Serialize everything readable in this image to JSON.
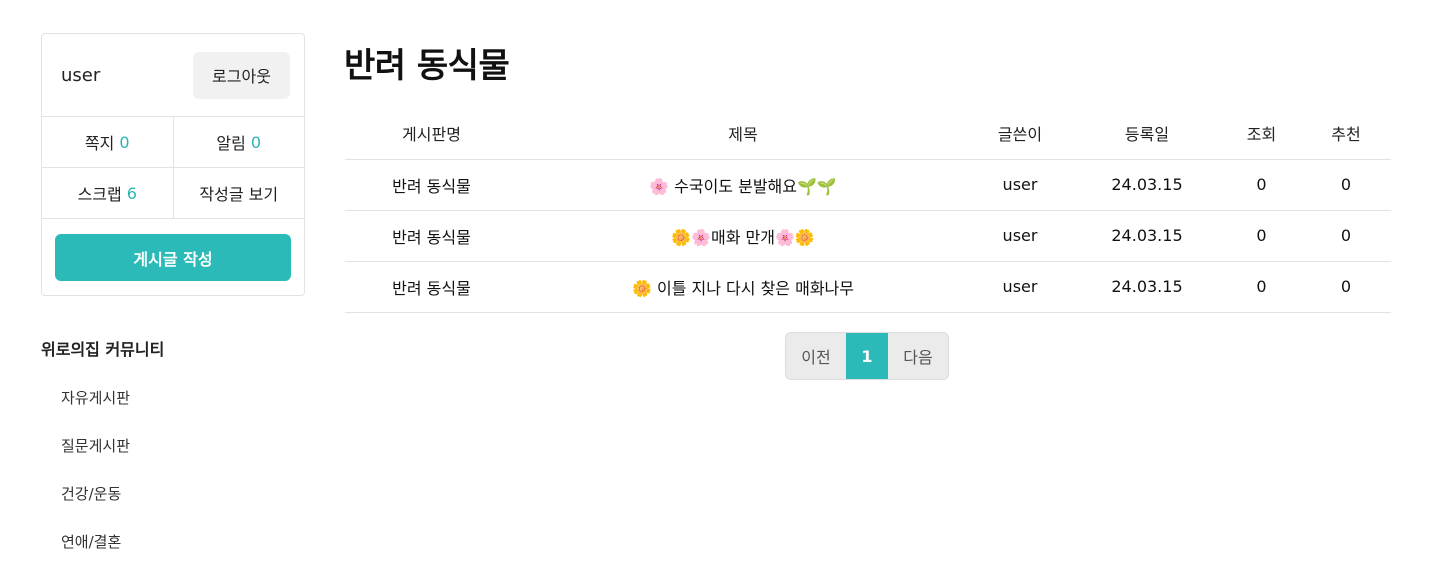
{
  "user_panel": {
    "username": "user",
    "logout_label": "로그아웃",
    "messages_label": "쪽지",
    "messages_count": "0",
    "alerts_label": "알림",
    "alerts_count": "0",
    "scrap_label": "스크랩",
    "scrap_count": "6",
    "my_posts_label": "작성글 보기",
    "write_label": "게시글 작성"
  },
  "community": {
    "title": "위로의집 커뮤니티",
    "items": [
      {
        "label": "자유게시판"
      },
      {
        "label": "질문게시판"
      },
      {
        "label": "건강/운동"
      },
      {
        "label": "연애/결혼"
      }
    ]
  },
  "board": {
    "title": "반려 동식물",
    "columns": [
      "게시판명",
      "제목",
      "글쓴이",
      "등록일",
      "조회",
      "추천"
    ],
    "rows": [
      {
        "board": "반려 동식물",
        "title": "🌸 수국이도 분발해요🌱🌱",
        "author": "user",
        "date": "24.03.15",
        "views": "0",
        "likes": "0"
      },
      {
        "board": "반려 동식물",
        "title": "🌼🌸매화 만개🌸🌼",
        "author": "user",
        "date": "24.03.15",
        "views": "0",
        "likes": "0"
      },
      {
        "board": "반려 동식물",
        "title": "🌼 이틀 지나 다시 찾은 매화나무",
        "author": "user",
        "date": "24.03.15",
        "views": "0",
        "likes": "0"
      }
    ]
  },
  "pagination": {
    "prev_label": "이전",
    "current_page": "1",
    "next_label": "다음"
  },
  "colors": {
    "accent": "#2bbab7"
  }
}
